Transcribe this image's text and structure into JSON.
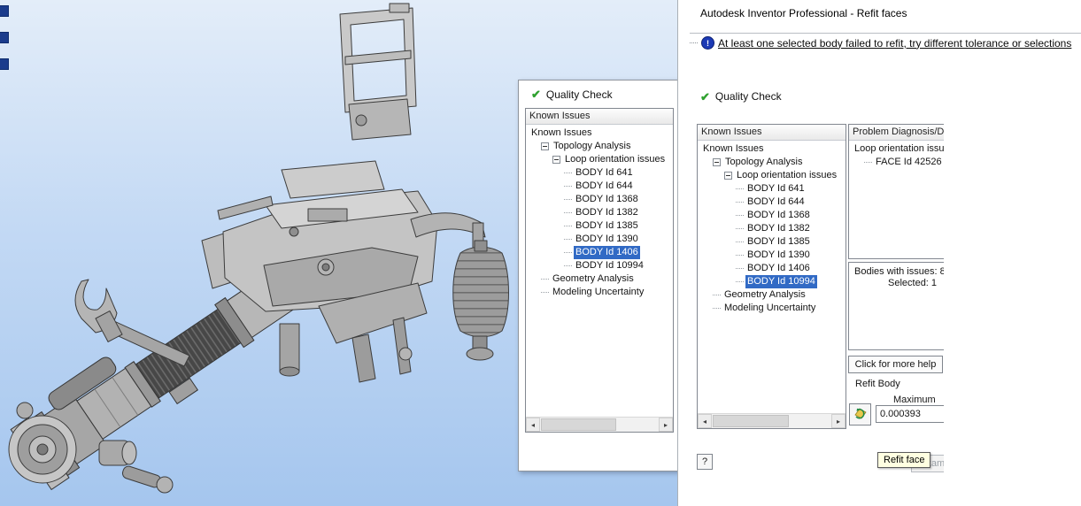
{
  "colors": {
    "selection": "#316ac5",
    "tooltip_bg": "#ffffe1",
    "check_green": "#2fa12f",
    "alert_blue": "#1c3ab5",
    "viewport_top": "#e3edf9",
    "viewport_bottom": "#a5c6ee"
  },
  "icons": {
    "check": "✔",
    "alert": "!",
    "scroll_left": "◂",
    "scroll_right": "▸"
  },
  "tree_items": [
    {
      "label": "Known Issues",
      "depth": 0
    },
    {
      "label": "Topology Analysis",
      "depth": 1,
      "expand": true
    },
    {
      "label": "Loop orientation issues",
      "depth": 2,
      "expand": true
    },
    {
      "label": "BODY Id 641",
      "depth": 3
    },
    {
      "label": "BODY Id 644",
      "depth": 3
    },
    {
      "label": "BODY Id 1368",
      "depth": 3
    },
    {
      "label": "BODY Id 1382",
      "depth": 3
    },
    {
      "label": "BODY Id 1385",
      "depth": 3
    },
    {
      "label": "BODY Id 1390",
      "depth": 3
    },
    {
      "label": "BODY Id 1406",
      "depth": 3
    },
    {
      "label": "BODY Id 10994",
      "depth": 3
    },
    {
      "label": "Geometry Analysis",
      "depth": 1
    },
    {
      "label": "Modeling Uncertainty",
      "depth": 1
    }
  ],
  "quality_dialog": {
    "title": "Quality Check",
    "panel_header": "Known Issues",
    "selected": "BODY Id 1406"
  },
  "refit_window": {
    "title": "Autodesk Inventor Professional - Refit faces",
    "warning_text": "At least one selected body failed to refit, try different tolerance or selections",
    "section_title": "Quality Check",
    "known_issues_header": "Known Issues",
    "selected": "BODY Id 10994",
    "diagnosis_header": "Problem Diagnosis/De",
    "diagnosis_items": [
      {
        "label": "Loop orientation issu",
        "depth": 0
      },
      {
        "label": "FACE Id 42526",
        "depth": 1
      }
    ],
    "summary_line1": "Bodies with issues: 8",
    "summary_line2": "Selected: 1",
    "help_button_label": "Click for more help",
    "refit_group_label": "Refit Body",
    "max_label": "Maximum",
    "deviation_value": "0.000393",
    "tooltip": "Refit face",
    "examine_label": "Exam",
    "context_help_label": "?"
  }
}
